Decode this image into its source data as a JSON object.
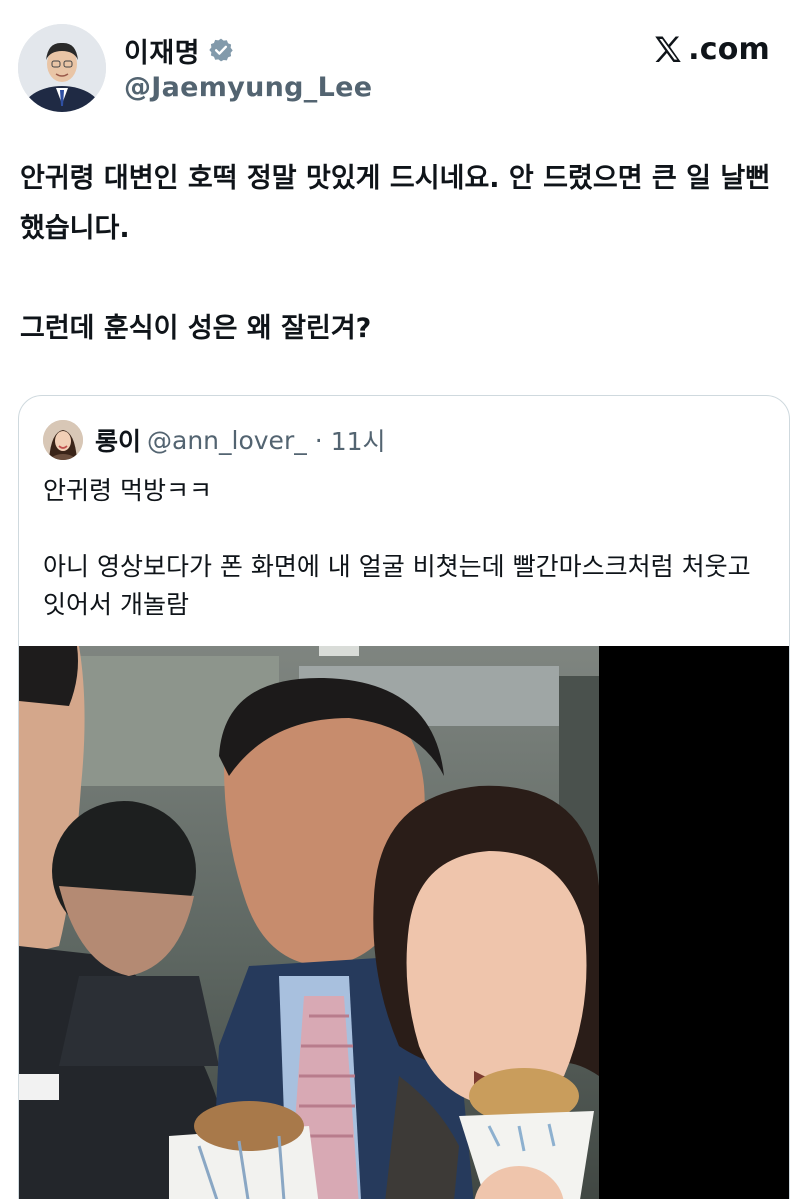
{
  "author": {
    "name": "이재명",
    "handle": "@Jaemyung_Lee",
    "verified": true
  },
  "brand": {
    "domain_text": ".com",
    "logo_icon": "x-logo-icon"
  },
  "tweet": {
    "lines": [
      "안귀령 대변인 호떡 정말 맛있게 드시네요. 안 드렸으면 큰 일 날뻔 했습니다.",
      "그런데 훈식이 성은 왜 잘린겨?"
    ]
  },
  "quoted": {
    "name": "롱이",
    "handle": "@ann_lover_",
    "separator": "·",
    "time": "11시",
    "lines": [
      "안귀령 먹방ㅋㅋ",
      "아니 영상보다가 폰 화면에 내 얼굴 비쳣는데 빨간마스크처럼 처웃고잇어서 개놀람"
    ],
    "media": {
      "kind": "video-still",
      "description_icon": "video-thumbnail"
    }
  },
  "colors": {
    "text_primary": "#0f1419",
    "text_secondary": "#536471",
    "verified_badge": "#829aab",
    "card_border": "#cfd9de"
  }
}
